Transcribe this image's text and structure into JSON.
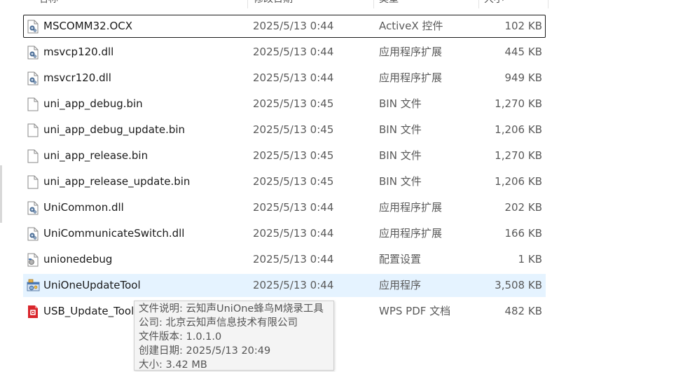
{
  "columns": {
    "name": "名称",
    "date": "修改日期",
    "type": "类型",
    "size": "大小"
  },
  "files": [
    {
      "name": "MSCOMM32.OCX",
      "date": "2025/5/13 0:44",
      "type": "ActiveX 控件",
      "size": "102 KB",
      "icon": "gear-file-icon"
    },
    {
      "name": "msvcp120.dll",
      "date": "2025/5/13 0:44",
      "type": "应用程序扩展",
      "size": "445 KB",
      "icon": "gear-file-icon"
    },
    {
      "name": "msvcr120.dll",
      "date": "2025/5/13 0:44",
      "type": "应用程序扩展",
      "size": "949 KB",
      "icon": "gear-file-icon"
    },
    {
      "name": "uni_app_debug.bin",
      "date": "2025/5/13 0:45",
      "type": "BIN 文件",
      "size": "1,270 KB",
      "icon": "blank-file-icon"
    },
    {
      "name": "uni_app_debug_update.bin",
      "date": "2025/5/13 0:45",
      "type": "BIN 文件",
      "size": "1,206 KB",
      "icon": "blank-file-icon"
    },
    {
      "name": "uni_app_release.bin",
      "date": "2025/5/13 0:45",
      "type": "BIN 文件",
      "size": "1,270 KB",
      "icon": "blank-file-icon"
    },
    {
      "name": "uni_app_release_update.bin",
      "date": "2025/5/13 0:45",
      "type": "BIN 文件",
      "size": "1,206 KB",
      "icon": "blank-file-icon"
    },
    {
      "name": "UniCommon.dll",
      "date": "2025/5/13 0:44",
      "type": "应用程序扩展",
      "size": "202 KB",
      "icon": "gear-file-icon"
    },
    {
      "name": "UniCommunicateSwitch.dll",
      "date": "2025/5/13 0:44",
      "type": "应用程序扩展",
      "size": "166 KB",
      "icon": "gear-file-icon"
    },
    {
      "name": "unionedebug",
      "date": "2025/5/13 0:44",
      "type": "配置设置",
      "size": "1 KB",
      "icon": "settings-file-icon"
    },
    {
      "name": "UniOneUpdateTool",
      "date": "2025/5/13 0:44",
      "type": "应用程序",
      "size": "3,508 KB",
      "icon": "app-exe-icon"
    },
    {
      "name": "USB_Update_Tool",
      "date": "",
      "type": "WPS PDF 文档",
      "size": "482 KB",
      "icon": "pdf-file-icon"
    }
  ],
  "tooltip": {
    "description": "文件说明: 云知声UniOne蜂鸟M烧录工具",
    "company": "公司: 北京云知声信息技术有限公司",
    "version": "文件版本: 1.0.1.0",
    "created": "创建日期: 2025/5/13 20:49",
    "size": "大小: 3.42 MB"
  },
  "colors": {
    "hover_bg": "#e5f3ff",
    "focus_border": "#1a1a1a",
    "pdf_red": "#d9262c"
  }
}
